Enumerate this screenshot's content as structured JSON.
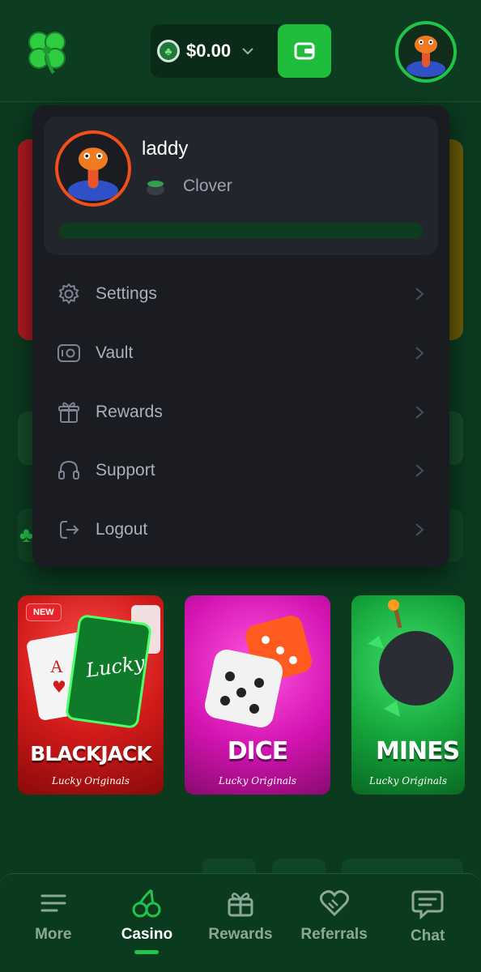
{
  "header": {
    "balance": "$0.00",
    "icons": {
      "logo": "clover-logo-icon",
      "coin": "clover-coin-icon",
      "dropdown": "chevron-down-icon",
      "wallet": "wallet-icon",
      "avatar": "snake-avatar"
    }
  },
  "games": [
    {
      "title": "BLACKJACK",
      "subtitle": "Lucky Originals",
      "badge": "NEW",
      "card_text": "Lucky"
    },
    {
      "title": "DICE",
      "subtitle": "Lucky Originals"
    },
    {
      "title": "MINES",
      "subtitle": "Lucky Originals"
    }
  ],
  "profile": {
    "username": "laddy",
    "rank": "Clover",
    "progress_percent": 0,
    "rank_icon": "pot-icon"
  },
  "menu": [
    {
      "label": "Settings",
      "icon": "gear-icon"
    },
    {
      "label": "Vault",
      "icon": "vault-icon"
    },
    {
      "label": "Rewards",
      "icon": "gift-icon"
    },
    {
      "label": "Support",
      "icon": "headset-icon"
    },
    {
      "label": "Logout",
      "icon": "logout-icon"
    }
  ],
  "bottom_nav": [
    {
      "label": "More",
      "icon": "menu-lines-icon",
      "active": false
    },
    {
      "label": "Casino",
      "icon": "cherries-icon",
      "active": true
    },
    {
      "label": "Rewards",
      "icon": "gift-icon",
      "active": false
    },
    {
      "label": "Referrals",
      "icon": "handshake-heart-icon",
      "active": false
    },
    {
      "label": "Chat",
      "icon": "chat-bubble-icon",
      "active": false
    }
  ],
  "colors": {
    "background": "#0b3a1f",
    "accent_green": "#22c34a",
    "dropdown_bg": "#1a1c22",
    "avatar_ring": "#f0501a"
  }
}
